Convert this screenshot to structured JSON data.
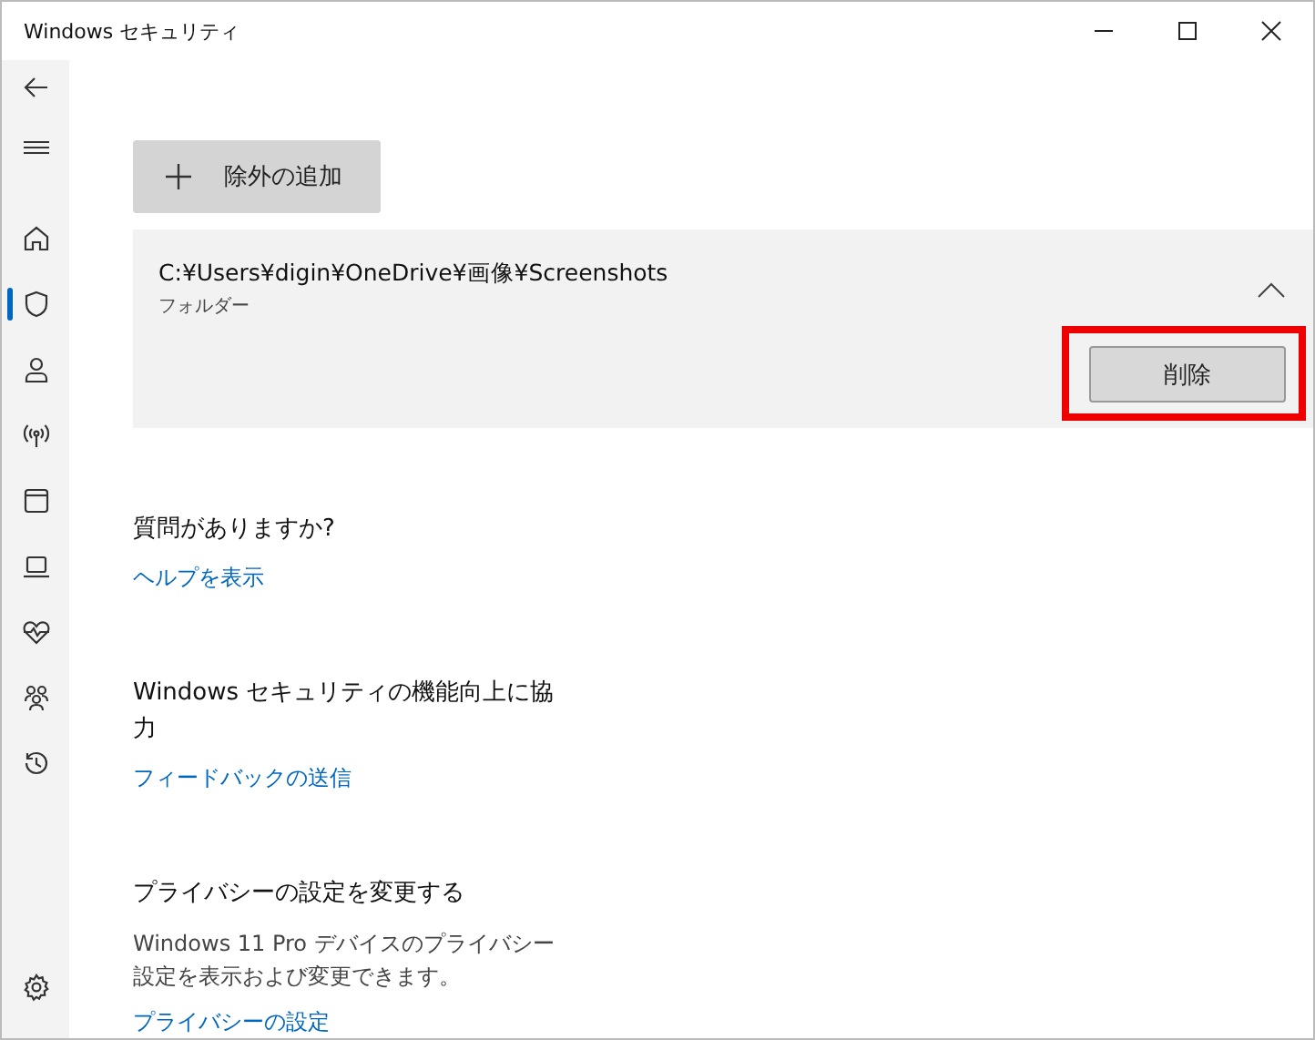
{
  "window": {
    "title": "Windows セキュリティ"
  },
  "sidebar": {
    "items": [
      {
        "kind": "back",
        "selected": false
      },
      {
        "kind": "menu",
        "selected": false
      },
      {
        "kind": "home",
        "selected": false
      },
      {
        "kind": "shield",
        "selected": true
      },
      {
        "kind": "person",
        "selected": false
      },
      {
        "kind": "antenna",
        "selected": false
      },
      {
        "kind": "window",
        "selected": false
      },
      {
        "kind": "laptop",
        "selected": false
      },
      {
        "kind": "heart",
        "selected": false
      },
      {
        "kind": "family",
        "selected": false
      },
      {
        "kind": "history",
        "selected": false
      },
      {
        "kind": "gear",
        "selected": false
      }
    ]
  },
  "add_button": {
    "label": "除外の追加"
  },
  "exclusion": {
    "path": "C:¥Users¥digin¥OneDrive¥画像¥Screenshots",
    "type": "フォルダー",
    "expanded": true,
    "remove_button": {
      "label": "削除",
      "highlighted": true
    }
  },
  "sections": [
    {
      "title": "質問がありますか?",
      "link": "ヘルプを表示"
    },
    {
      "title": "Windows セキュリティの機能向上に協力",
      "link": "フィードバックの送信"
    },
    {
      "title": "プライバシーの設定を変更する",
      "text": "Windows 11 Pro デバイスのプライバシー設定を表示および変更できます。",
      "link": "プライバシーの設定"
    }
  ]
}
